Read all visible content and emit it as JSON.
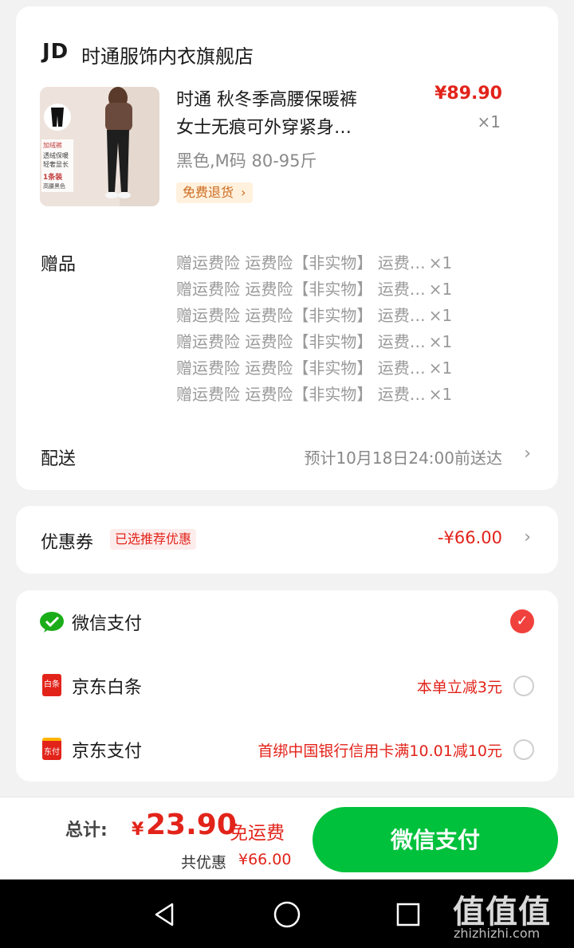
{
  "order": {
    "store": {
      "logo": "JD",
      "name": "时通服饰内衣旗舰店"
    },
    "product": {
      "title_line1": "时通 秋冬季高腰保暖裤",
      "title_line2": "女士无痕可外穿紧身…",
      "price": "¥89.90",
      "qty": "×1",
      "spec": "黑色,M码 80-95斤",
      "return_tag": "免费退货",
      "thumb_text": [
        "加绒裤",
        "透绒保暖",
        "轻奢显长",
        "1条装",
        "高腰黑色"
      ]
    },
    "gifts": {
      "label": "赠品",
      "items": [
        {
          "text": "赠运费险 运费险【非实物】 运费…",
          "qty": "×1"
        },
        {
          "text": "赠运费险 运费险【非实物】 运费…",
          "qty": "×1"
        },
        {
          "text": "赠运费险 运费险【非实物】 运费…",
          "qty": "×1"
        },
        {
          "text": "赠运费险 运费险【非实物】 运费…",
          "qty": "×1"
        },
        {
          "text": "赠运费险 运费险【非实物】 运费…",
          "qty": "×1"
        },
        {
          "text": "赠运费险 运费险【非实物】 运费…",
          "qty": "×1"
        }
      ]
    },
    "delivery": {
      "label": "配送",
      "value": "预计10月18日24:00前送达"
    }
  },
  "coupon": {
    "label": "优惠券",
    "tag": "已选推荐优惠",
    "value": "-¥66.00"
  },
  "payment": {
    "methods": [
      {
        "name": "微信支付",
        "note": "",
        "selected": true,
        "icon": "wechat-pay-icon"
      },
      {
        "name": "京东白条",
        "note": "本单立减3元",
        "selected": false,
        "icon": "baitiao-icon",
        "icon_text": "白条"
      },
      {
        "name": "京东支付",
        "note": "首绑中国银行信用卡满10.01减10元",
        "selected": false,
        "icon": "jd-pay-icon",
        "icon_text": "东付"
      }
    ]
  },
  "summary": {
    "total_label": "总计:",
    "yen": "¥",
    "total": "23.90",
    "free_shipping": "免运费",
    "discount_label": "共优惠",
    "discount": "¥66.00",
    "pay_button": "微信支付"
  },
  "watermark": {
    "big": "值值值",
    "small": "zhizhizhi.com"
  },
  "colors": {
    "accent_red": "#e2231a",
    "wechat_green": "#00c13c",
    "background": "#f2f2f2"
  }
}
